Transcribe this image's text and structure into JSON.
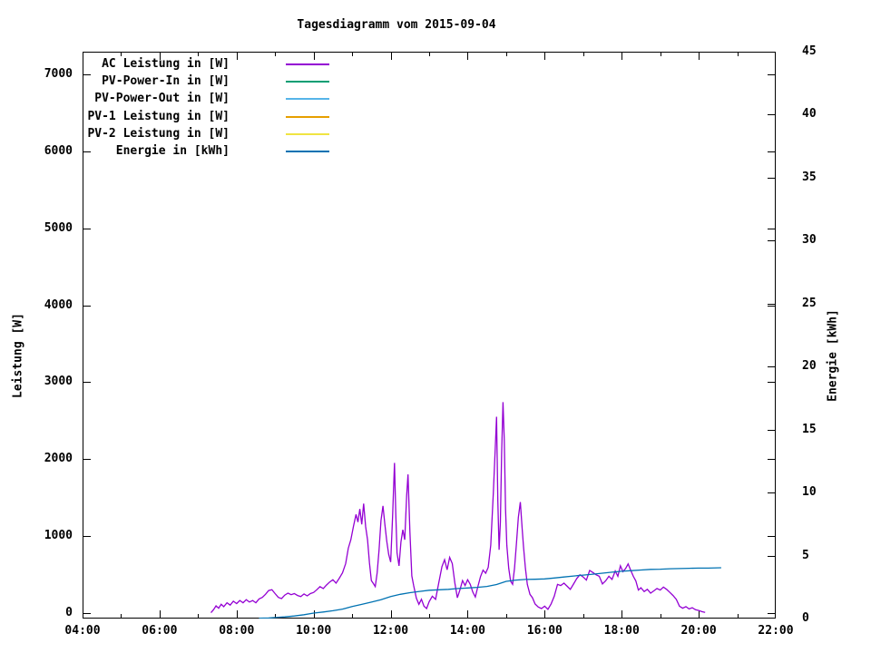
{
  "title": "Tagesdiagramm vom 2015-09-04",
  "chart_data": {
    "type": "line",
    "title": "Tagesdiagramm vom 2015-09-04",
    "grid": false,
    "legend_position": "top-left-inside",
    "background_color": "#ffffff",
    "x_axis": {
      "label": "",
      "unit": "time",
      "range_hours": [
        4,
        22
      ],
      "tick_labels": [
        "04:00",
        "06:00",
        "08:00",
        "10:00",
        "12:00",
        "14:00",
        "16:00",
        "18:00",
        "20:00",
        "22:00"
      ],
      "minor_tick_every_hour": true
    },
    "y_axis": {
      "label": "Leistung [W]",
      "range": [
        -75,
        7300
      ],
      "tick_step": 1000,
      "tick_labels": [
        "0",
        "1000",
        "2000",
        "3000",
        "4000",
        "5000",
        "6000",
        "7000"
      ]
    },
    "y2_axis": {
      "label": "Energie [kWh]",
      "range": [
        0,
        45
      ],
      "tick_step": 5,
      "tick_labels": [
        "0",
        "5",
        "10",
        "15",
        "20",
        "25",
        "30",
        "35",
        "40",
        "45"
      ]
    },
    "legend": [
      {
        "label": "AC Leistung in [W]",
        "color": "#9400d3"
      },
      {
        "label": "PV-Power-In in [W]",
        "color": "#009e73"
      },
      {
        "label": "PV-Power-Out in [W]",
        "color": "#56b4e9"
      },
      {
        "label": "PV-1 Leistung in [W]",
        "color": "#e69f00"
      },
      {
        "label": "PV-2 Leistung in [W]",
        "color": "#f0e442"
      },
      {
        "label": "Energie in [kWh]",
        "color": "#0072b2"
      }
    ],
    "series": [
      {
        "name": "AC Leistung in [W]",
        "axis": "y",
        "color": "#9400d3",
        "points": [
          [
            "07:20",
            0
          ],
          [
            "07:24",
            40
          ],
          [
            "07:28",
            90
          ],
          [
            "07:32",
            60
          ],
          [
            "07:36",
            110
          ],
          [
            "07:40",
            80
          ],
          [
            "07:45",
            130
          ],
          [
            "07:50",
            100
          ],
          [
            "07:55",
            150
          ],
          [
            "08:00",
            120
          ],
          [
            "08:05",
            160
          ],
          [
            "08:10",
            130
          ],
          [
            "08:15",
            170
          ],
          [
            "08:20",
            140
          ],
          [
            "08:25",
            160
          ],
          [
            "08:30",
            130
          ],
          [
            "08:35",
            180
          ],
          [
            "08:40",
            200
          ],
          [
            "08:45",
            240
          ],
          [
            "08:50",
            290
          ],
          [
            "08:55",
            300
          ],
          [
            "09:00",
            250
          ],
          [
            "09:05",
            200
          ],
          [
            "09:10",
            185
          ],
          [
            "09:15",
            230
          ],
          [
            "09:20",
            255
          ],
          [
            "09:25",
            235
          ],
          [
            "09:30",
            250
          ],
          [
            "09:35",
            225
          ],
          [
            "09:40",
            210
          ],
          [
            "09:45",
            245
          ],
          [
            "09:50",
            220
          ],
          [
            "09:55",
            250
          ],
          [
            "10:00",
            265
          ],
          [
            "10:05",
            300
          ],
          [
            "10:10",
            340
          ],
          [
            "10:15",
            315
          ],
          [
            "10:20",
            360
          ],
          [
            "10:25",
            400
          ],
          [
            "10:30",
            430
          ],
          [
            "10:35",
            385
          ],
          [
            "10:40",
            450
          ],
          [
            "10:45",
            520
          ],
          [
            "10:50",
            640
          ],
          [
            "10:54",
            840
          ],
          [
            "10:58",
            950
          ],
          [
            "11:02",
            1120
          ],
          [
            "11:06",
            1280
          ],
          [
            "11:09",
            1180
          ],
          [
            "11:12",
            1350
          ],
          [
            "11:15",
            1150
          ],
          [
            "11:18",
            1420
          ],
          [
            "11:21",
            1120
          ],
          [
            "11:24",
            950
          ],
          [
            "11:27",
            650
          ],
          [
            "11:30",
            420
          ],
          [
            "11:33",
            380
          ],
          [
            "11:36",
            340
          ],
          [
            "11:39",
            520
          ],
          [
            "11:42",
            820
          ],
          [
            "11:45",
            1200
          ],
          [
            "11:48",
            1390
          ],
          [
            "11:51",
            1150
          ],
          [
            "11:54",
            930
          ],
          [
            "11:57",
            760
          ],
          [
            "12:00",
            660
          ],
          [
            "12:03",
            1250
          ],
          [
            "12:06",
            1950
          ],
          [
            "12:08",
            1300
          ],
          [
            "12:10",
            780
          ],
          [
            "12:13",
            610
          ],
          [
            "12:16",
            920
          ],
          [
            "12:19",
            1080
          ],
          [
            "12:22",
            950
          ],
          [
            "12:25",
            1520
          ],
          [
            "12:27",
            1800
          ],
          [
            "12:30",
            1050
          ],
          [
            "12:33",
            480
          ],
          [
            "12:36",
            350
          ],
          [
            "12:40",
            190
          ],
          [
            "12:44",
            110
          ],
          [
            "12:48",
            175
          ],
          [
            "12:52",
            85
          ],
          [
            "12:56",
            55
          ],
          [
            "13:00",
            145
          ],
          [
            "13:05",
            215
          ],
          [
            "13:10",
            175
          ],
          [
            "13:15",
            390
          ],
          [
            "13:20",
            600
          ],
          [
            "13:24",
            690
          ],
          [
            "13:28",
            560
          ],
          [
            "13:32",
            720
          ],
          [
            "13:36",
            640
          ],
          [
            "13:40",
            390
          ],
          [
            "13:44",
            195
          ],
          [
            "13:48",
            300
          ],
          [
            "13:52",
            420
          ],
          [
            "13:56",
            355
          ],
          [
            "14:00",
            430
          ],
          [
            "14:04",
            370
          ],
          [
            "14:08",
            270
          ],
          [
            "14:12",
            205
          ],
          [
            "14:16",
            345
          ],
          [
            "14:20",
            470
          ],
          [
            "14:24",
            555
          ],
          [
            "14:28",
            515
          ],
          [
            "14:32",
            590
          ],
          [
            "14:36",
            880
          ],
          [
            "14:40",
            1550
          ],
          [
            "14:43",
            2150
          ],
          [
            "14:45",
            2550
          ],
          [
            "14:47",
            1450
          ],
          [
            "14:49",
            820
          ],
          [
            "14:51",
            1180
          ],
          [
            "14:53",
            2080
          ],
          [
            "14:55",
            2740
          ],
          [
            "14:57",
            2250
          ],
          [
            "14:59",
            1350
          ],
          [
            "15:01",
            880
          ],
          [
            "15:04",
            580
          ],
          [
            "15:07",
            410
          ],
          [
            "15:10",
            370
          ],
          [
            "15:13",
            580
          ],
          [
            "15:16",
            900
          ],
          [
            "15:19",
            1240
          ],
          [
            "15:22",
            1440
          ],
          [
            "15:25",
            1080
          ],
          [
            "15:27",
            860
          ],
          [
            "15:30",
            580
          ],
          [
            "15:33",
            370
          ],
          [
            "15:37",
            240
          ],
          [
            "15:41",
            195
          ],
          [
            "15:45",
            115
          ],
          [
            "15:50",
            75
          ],
          [
            "15:55",
            55
          ],
          [
            "16:00",
            85
          ],
          [
            "16:05",
            45
          ],
          [
            "16:10",
            115
          ],
          [
            "16:15",
            215
          ],
          [
            "16:20",
            370
          ],
          [
            "16:25",
            355
          ],
          [
            "16:30",
            385
          ],
          [
            "16:35",
            345
          ],
          [
            "16:40",
            305
          ],
          [
            "16:45",
            375
          ],
          [
            "16:50",
            445
          ],
          [
            "16:55",
            495
          ],
          [
            "17:00",
            465
          ],
          [
            "17:05",
            425
          ],
          [
            "17:10",
            550
          ],
          [
            "17:15",
            525
          ],
          [
            "17:20",
            495
          ],
          [
            "17:25",
            475
          ],
          [
            "17:30",
            375
          ],
          [
            "17:35",
            415
          ],
          [
            "17:40",
            475
          ],
          [
            "17:45",
            435
          ],
          [
            "17:50",
            545
          ],
          [
            "17:54",
            475
          ],
          [
            "17:58",
            610
          ],
          [
            "18:02",
            535
          ],
          [
            "18:06",
            575
          ],
          [
            "18:10",
            635
          ],
          [
            "18:14",
            555
          ],
          [
            "18:18",
            475
          ],
          [
            "18:22",
            415
          ],
          [
            "18:26",
            295
          ],
          [
            "18:30",
            325
          ],
          [
            "18:35",
            275
          ],
          [
            "18:40",
            305
          ],
          [
            "18:45",
            255
          ],
          [
            "18:50",
            285
          ],
          [
            "18:55",
            315
          ],
          [
            "19:00",
            295
          ],
          [
            "19:05",
            335
          ],
          [
            "19:10",
            305
          ],
          [
            "19:15",
            265
          ],
          [
            "19:20",
            225
          ],
          [
            "19:25",
            175
          ],
          [
            "19:30",
            85
          ],
          [
            "19:35",
            60
          ],
          [
            "19:40",
            80
          ],
          [
            "19:45",
            50
          ],
          [
            "19:50",
            65
          ],
          [
            "19:55",
            40
          ],
          [
            "20:00",
            30
          ],
          [
            "20:05",
            15
          ],
          [
            "20:10",
            5
          ]
        ]
      },
      {
        "name": "PV-Power-In in [W]",
        "axis": "y",
        "color": "#009e73",
        "points": []
      },
      {
        "name": "PV-Power-Out in [W]",
        "axis": "y",
        "color": "#56b4e9",
        "points": []
      },
      {
        "name": "PV-1 Leistung in [W]",
        "axis": "y",
        "color": "#e69f00",
        "points": []
      },
      {
        "name": "PV-2 Leistung in [W]",
        "axis": "y",
        "color": "#f0e442",
        "points": []
      },
      {
        "name": "Energie in [kWh]",
        "axis": "y2",
        "color": "#0072b2",
        "points": [
          [
            "08:35",
            0.02
          ],
          [
            "08:50",
            0.04
          ],
          [
            "09:00",
            0.08
          ],
          [
            "09:15",
            0.13
          ],
          [
            "09:30",
            0.2
          ],
          [
            "09:45",
            0.3
          ],
          [
            "10:00",
            0.43
          ],
          [
            "10:15",
            0.52
          ],
          [
            "10:30",
            0.62
          ],
          [
            "10:45",
            0.75
          ],
          [
            "11:00",
            0.95
          ],
          [
            "11:15",
            1.12
          ],
          [
            "11:30",
            1.3
          ],
          [
            "11:45",
            1.5
          ],
          [
            "12:00",
            1.75
          ],
          [
            "12:15",
            1.92
          ],
          [
            "12:30",
            2.05
          ],
          [
            "12:45",
            2.15
          ],
          [
            "13:00",
            2.25
          ],
          [
            "13:15",
            2.28
          ],
          [
            "13:30",
            2.32
          ],
          [
            "13:45",
            2.38
          ],
          [
            "14:00",
            2.43
          ],
          [
            "14:15",
            2.48
          ],
          [
            "14:30",
            2.55
          ],
          [
            "14:45",
            2.7
          ],
          [
            "15:00",
            2.95
          ],
          [
            "15:15",
            3.05
          ],
          [
            "15:30",
            3.1
          ],
          [
            "15:45",
            3.12
          ],
          [
            "16:00",
            3.15
          ],
          [
            "16:15",
            3.22
          ],
          [
            "16:30",
            3.3
          ],
          [
            "16:45",
            3.38
          ],
          [
            "17:00",
            3.45
          ],
          [
            "17:15",
            3.52
          ],
          [
            "17:30",
            3.6
          ],
          [
            "17:45",
            3.68
          ],
          [
            "18:00",
            3.75
          ],
          [
            "18:15",
            3.8
          ],
          [
            "18:30",
            3.85
          ],
          [
            "18:45",
            3.9
          ],
          [
            "19:00",
            3.92
          ],
          [
            "19:15",
            3.95
          ],
          [
            "19:30",
            3.97
          ],
          [
            "19:45",
            3.99
          ],
          [
            "20:00",
            4.0
          ],
          [
            "20:15",
            4.0
          ],
          [
            "20:35",
            4.03
          ]
        ]
      }
    ]
  }
}
